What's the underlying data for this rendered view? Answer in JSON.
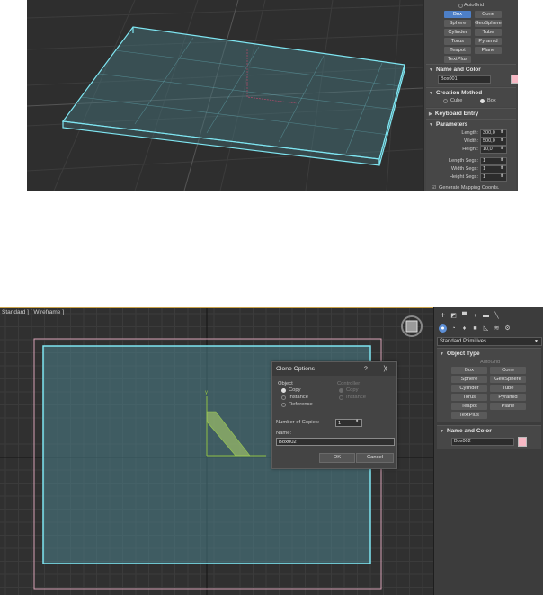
{
  "top": {
    "panel": {
      "autogrid_label": "AutoGrid",
      "primitives": [
        "Box",
        "Cone",
        "Sphere",
        "GeoSphere",
        "Cylinder",
        "Tube",
        "Torus",
        "Pyramid",
        "Teapot",
        "Plane",
        "TextPlus"
      ],
      "name_color_title": "Name and Color",
      "object_name": "Box001",
      "creation_method_title": "Creation Method",
      "creation_options": [
        "Cube",
        "Box"
      ],
      "keyboard_entry_title": "Keyboard Entry",
      "parameters_title": "Parameters",
      "params": [
        {
          "label": "Length:",
          "value": "300,0"
        },
        {
          "label": "Width:",
          "value": "500,0"
        },
        {
          "label": "Height:",
          "value": "10,0"
        },
        {
          "label": "Length Segs:",
          "value": "1"
        },
        {
          "label": "Width Segs:",
          "value": "1"
        },
        {
          "label": "Height Segs:",
          "value": "1"
        }
      ],
      "gen_mapping_label": "Generate Mapping Coords."
    }
  },
  "bottom": {
    "viewport_label": "Standard ] [ Wireframe ]",
    "axis_y": "y",
    "panel": {
      "dropdown_value": "Standard Primitives",
      "object_type_title": "Object Type",
      "autogrid_label": "AutoGrid",
      "primitives": [
        "Box",
        "Cone",
        "Sphere",
        "GeoSphere",
        "Cylinder",
        "Tube",
        "Torus",
        "Pyramid",
        "Teapot",
        "Plane",
        "TextPlus"
      ],
      "name_color_title": "Name and Color",
      "object_name": "Box002"
    },
    "dialog": {
      "title": "Clone Options",
      "help": "?",
      "close": "╳",
      "object_group": "Object",
      "object_options": [
        "Copy",
        "Instance",
        "Reference"
      ],
      "controller_group": "Controller",
      "controller_options": [
        "Copy",
        "Instance"
      ],
      "copies_label": "Number of Copies:",
      "copies_value": "1",
      "name_label": "Name:",
      "name_value": "Box002",
      "ok_label": "OK",
      "cancel_label": "Cancel"
    }
  },
  "colors": {
    "selection_cyan": "#7fe6f2",
    "swatch_pink": "#f7b8c4",
    "accent_blue": "#4d7fc7"
  }
}
